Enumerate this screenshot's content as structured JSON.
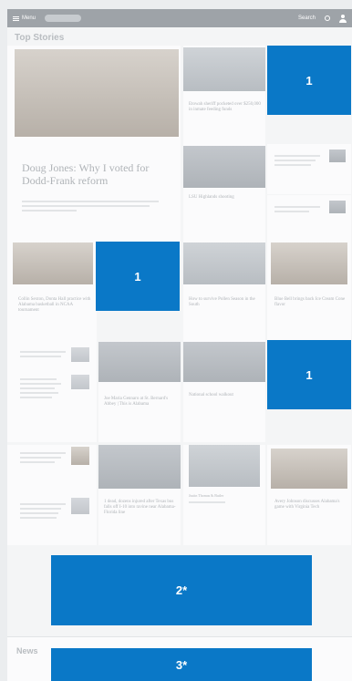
{
  "topbar": {
    "menu_label": "Menu",
    "edition_label": "",
    "search_label": "Search"
  },
  "section": {
    "title": "Top Stories",
    "tabs": [
      "",
      "",
      ""
    ]
  },
  "lead": {
    "label": "",
    "headline": "Doug Jones: Why I voted for Dodd-Frank reform",
    "dek": "",
    "meta": ""
  },
  "stories": [
    {
      "headline": "Etowah sheriff pocketed over $250,000 in inmate feeding funds"
    },
    {
      "headline": "LSU Highlands shooting"
    },
    {
      "headline": ""
    },
    {
      "headline": ""
    },
    {
      "headline": "Collin Sexton, Donta Hall practice with Alabama basketball in NCAA tournament"
    },
    {
      "headline": "How to survive Pollen Season in the South"
    },
    {
      "headline": "Blue Bell brings back Ice Cream Cone flavor"
    },
    {
      "headline": "Joe Maria Gennaro at St. Bernard's Abbey | This is Alabama"
    },
    {
      "headline": "National school walkout"
    },
    {
      "headline": "1 dead, dozens injured after Texas bus falls off I-10 into ravine near Alabama-Florida line"
    },
    {
      "headline": "Justin Thomas & Butler"
    },
    {
      "headline": "Avery Johnson discusses Alabama's game with Virginia Tech"
    }
  ],
  "ads": [
    {
      "label": "1"
    },
    {
      "label": "1"
    },
    {
      "label": "1"
    },
    {
      "label": "2*"
    },
    {
      "label": "3*"
    }
  ],
  "news": {
    "title": "News"
  },
  "colors": {
    "ad_blue": "#0a78c7",
    "background": "#ebedef"
  },
  "icons": [
    "menu-icon",
    "search-icon",
    "user-icon"
  ]
}
